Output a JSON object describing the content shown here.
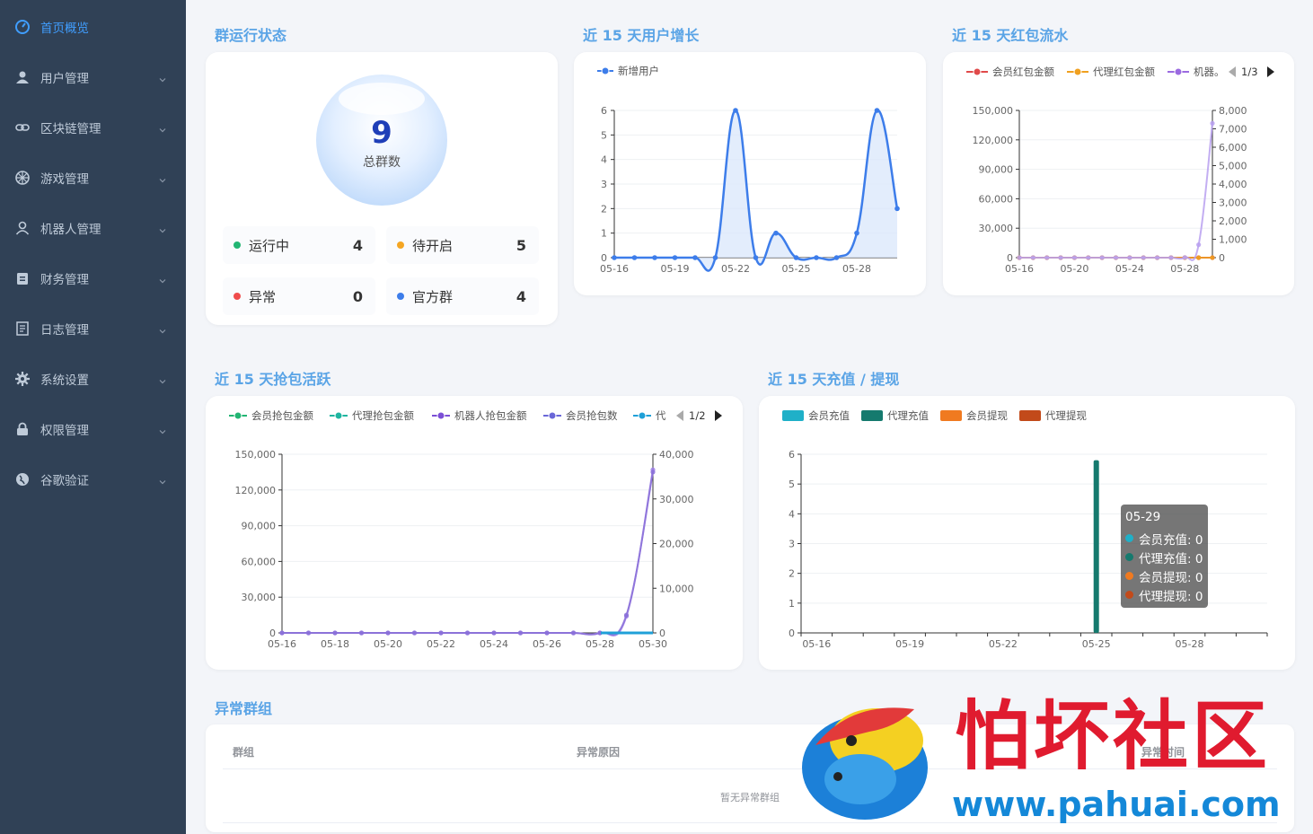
{
  "sidebar": {
    "items": [
      {
        "label": "首页概览",
        "icon": "dashboard-icon",
        "active": true
      },
      {
        "label": "用户管理",
        "icon": "user-icon"
      },
      {
        "label": "区块链管理",
        "icon": "link-icon"
      },
      {
        "label": "游戏管理",
        "icon": "dice-icon"
      },
      {
        "label": "机器人管理",
        "icon": "robot-user-icon"
      },
      {
        "label": "财务管理",
        "icon": "clipboard-icon"
      },
      {
        "label": "日志管理",
        "icon": "document-icon"
      },
      {
        "label": "系统设置",
        "icon": "gear-icon"
      },
      {
        "label": "权限管理",
        "icon": "lock-icon"
      },
      {
        "label": "谷歌验证",
        "icon": "globe-icon"
      }
    ]
  },
  "group_status": {
    "title": "群运行状态",
    "total": "9",
    "total_label": "总群数",
    "stats": [
      {
        "label": "运行中",
        "value": "4",
        "color": "#22b573"
      },
      {
        "label": "待开启",
        "value": "5",
        "color": "#f5a623"
      },
      {
        "label": "异常",
        "value": "0",
        "color": "#ef4c4c"
      },
      {
        "label": "官方群",
        "value": "4",
        "color": "#3d7dea"
      }
    ]
  },
  "user_growth": {
    "title": "近 15 天用户增长",
    "chart_data": {
      "type": "line",
      "x": [
        "05-16",
        "05-17",
        "05-18",
        "05-19",
        "05-20",
        "05-21",
        "05-22",
        "05-23",
        "05-24",
        "05-25",
        "05-26",
        "05-27",
        "05-28",
        "05-29",
        "05-30"
      ],
      "series": [
        {
          "name": "新增用户",
          "values": [
            0,
            0,
            0,
            0,
            0,
            0,
            6,
            0,
            1,
            0,
            0,
            0,
            1,
            6,
            2
          ],
          "color": "#3d7dea"
        }
      ],
      "ylim": [
        0,
        6
      ],
      "yticks": [
        "0",
        "1",
        "2",
        "3",
        "4",
        "5",
        "6"
      ],
      "xtick_labels": [
        "05-16",
        "05-19",
        "05-22",
        "05-25",
        "05-28"
      ]
    }
  },
  "red_packet_flow": {
    "title": "近 15 天红包流水",
    "legend": [
      {
        "name": "会员红包金额",
        "color": "#e04a4a"
      },
      {
        "name": "代理红包金额",
        "color": "#f0a020"
      },
      {
        "name": "机器。",
        "color": "#9b6ae0"
      }
    ],
    "pager": "1/3",
    "chart_data": {
      "type": "line",
      "x": [
        "05-16",
        "05-17",
        "05-18",
        "05-19",
        "05-20",
        "05-21",
        "05-22",
        "05-23",
        "05-24",
        "05-25",
        "05-26",
        "05-27",
        "05-28",
        "05-29",
        "05-30"
      ],
      "series": [
        {
          "name": "会员红包金额",
          "values": [
            0,
            0,
            0,
            0,
            0,
            0,
            0,
            0,
            0,
            0,
            0,
            0,
            0,
            0,
            0
          ],
          "axis": "left"
        },
        {
          "name": "代理红包金额",
          "values": [
            0,
            0,
            0,
            0,
            0,
            0,
            0,
            0,
            0,
            0,
            0,
            0,
            0,
            0,
            0
          ],
          "axis": "left"
        },
        {
          "name": "机器。",
          "values": [
            0,
            0,
            0,
            0,
            0,
            0,
            0,
            0,
            0,
            0,
            0,
            0,
            10,
            700,
            7300
          ],
          "axis": "right"
        }
      ],
      "left_ticks": [
        "0",
        "30,000",
        "60,000",
        "90,000",
        "120,000",
        "150,000"
      ],
      "right_ticks": [
        "0",
        "1,000",
        "2,000",
        "3,000",
        "4,000",
        "5,000",
        "6,000",
        "7,000",
        "8,000"
      ],
      "xtick_labels": [
        "05-16",
        "05-20",
        "05-24",
        "05-28"
      ]
    }
  },
  "grab_activity": {
    "title": "近 15 天抢包活跃",
    "legend": [
      {
        "name": "会员抢包金额",
        "color": "#22b573"
      },
      {
        "name": "代理抢包金额",
        "color": "#1fb5a0"
      },
      {
        "name": "机器人抢包金额",
        "color": "#7b4fd6"
      },
      {
        "name": "会员抢包数",
        "color": "#6a67d8"
      },
      {
        "name": "代",
        "color": "#1fa0d8"
      }
    ],
    "pager": "1/2",
    "chart_data": {
      "type": "line",
      "x": [
        "05-16",
        "05-17",
        "05-18",
        "05-19",
        "05-20",
        "05-21",
        "05-22",
        "05-23",
        "05-24",
        "05-25",
        "05-26",
        "05-27",
        "05-28",
        "05-29",
        "05-30"
      ],
      "series": [
        {
          "name": "机器人抢包金额",
          "values": [
            0,
            0,
            0,
            0,
            0,
            0,
            0,
            0,
            0,
            0,
            0,
            0,
            0,
            14000,
            137000
          ],
          "axis": "left"
        },
        {
          "name": "会员抢包数",
          "values": [
            0,
            0,
            0,
            0,
            0,
            0,
            0,
            0,
            0,
            0,
            0,
            0,
            0,
            4000,
            36000
          ],
          "axis": "right"
        }
      ],
      "left_ticks": [
        "0",
        "30,000",
        "60,000",
        "90,000",
        "120,000",
        "150,000"
      ],
      "right_ticks": [
        "0",
        "10,000",
        "20,000",
        "30,000",
        "40,000"
      ],
      "xtick_labels": [
        "05-16",
        "05-18",
        "05-20",
        "05-22",
        "05-24",
        "05-26",
        "05-28",
        "05-30"
      ]
    }
  },
  "recharge": {
    "title": "近 15 天充值 / 提现",
    "legend": [
      {
        "name": "会员充值",
        "color": "#1fb0c8"
      },
      {
        "name": "代理充值",
        "color": "#157a6e"
      },
      {
        "name": "会员提现",
        "color": "#f07a20"
      },
      {
        "name": "代理提现",
        "color": "#c24a1a"
      }
    ],
    "chart_data": {
      "type": "bar",
      "x": [
        "05-16",
        "05-17",
        "05-18",
        "05-19",
        "05-20",
        "05-21",
        "05-22",
        "05-23",
        "05-24",
        "05-25",
        "05-26",
        "05-27",
        "05-28",
        "05-29",
        "05-30"
      ],
      "series": [
        {
          "name": "代理充值",
          "values": [
            0,
            0,
            0,
            0,
            0,
            0,
            0,
            0,
            0,
            5.8,
            0,
            0,
            0,
            0,
            0
          ]
        }
      ],
      "yticks": [
        "0",
        "1",
        "2",
        "3",
        "4",
        "5",
        "6"
      ],
      "xtick_labels": [
        "05-16",
        "05-19",
        "05-22",
        "05-25",
        "05-28"
      ]
    },
    "tooltip": {
      "date": "05-29",
      "rows": [
        {
          "label": "会员充值: 0",
          "color": "#1fb0c8"
        },
        {
          "label": "代理充值: 0",
          "color": "#157a6e"
        },
        {
          "label": "会员提现: 0",
          "color": "#f07a20"
        },
        {
          "label": "代理提现: 0",
          "color": "#c24a1a"
        }
      ]
    }
  },
  "abnormal": {
    "title": "异常群组",
    "col_group": "群组",
    "col_reason": "异常原因",
    "col_time": "异常时间",
    "empty": "暂无异常群组"
  },
  "watermark": {
    "site": "怕坏社区",
    "url": "www.pahuai.com"
  }
}
